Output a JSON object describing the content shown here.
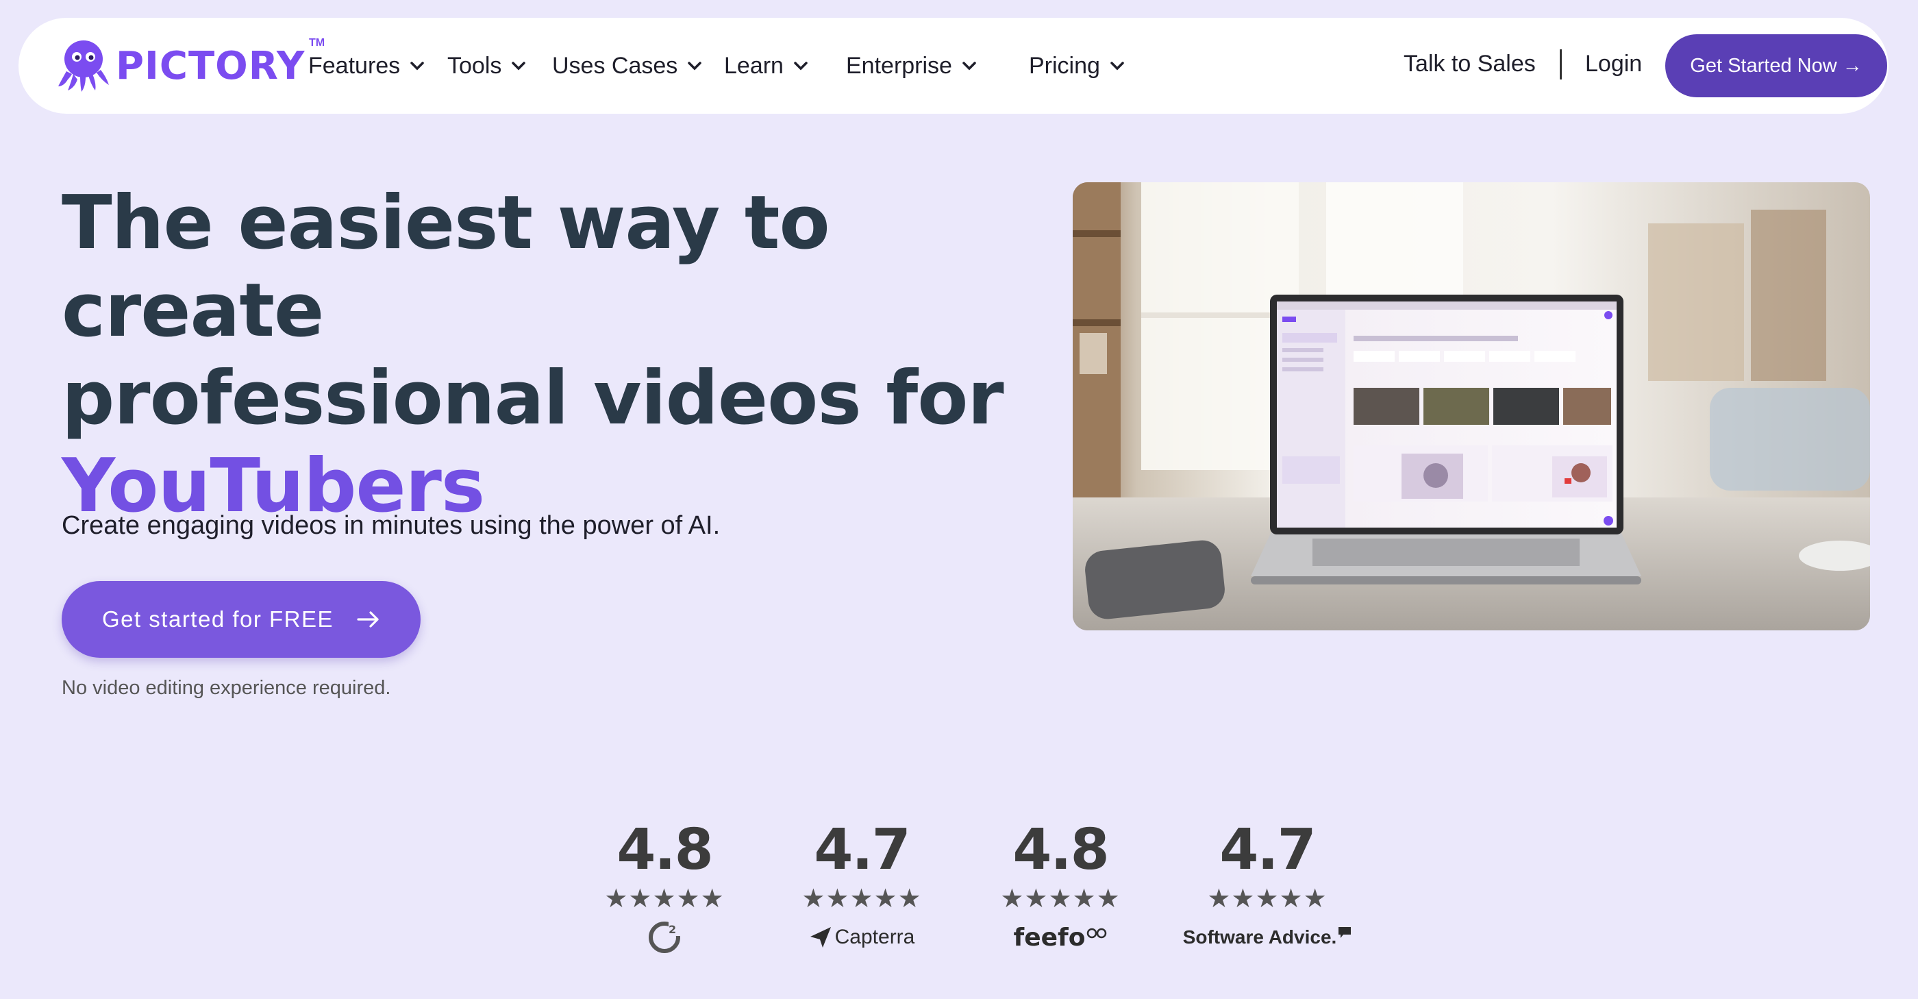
{
  "brand": {
    "name": "PICTORY",
    "trademark": "TM",
    "color": "#7b4cf0"
  },
  "nav": {
    "items": [
      {
        "label": "Features"
      },
      {
        "label": "Tools"
      },
      {
        "label": "Uses Cases"
      },
      {
        "label": "Learn"
      },
      {
        "label": "Enterprise"
      },
      {
        "label": "Pricing"
      }
    ],
    "talk_to_sales": "Talk to Sales",
    "login": "Login",
    "cta": "Get Started Now →"
  },
  "hero": {
    "headline_line1": "The easiest way to create",
    "headline_line2": "professional videos for",
    "headline_accent": "YouTubers",
    "subheadline": "Create engaging videos in minutes using the power of AI.",
    "cta": "Get started for FREE",
    "note": "No video editing experience required."
  },
  "ratings": [
    {
      "score": "4.8",
      "stars": "★★★★★",
      "source": "G2"
    },
    {
      "score": "4.7",
      "stars": "★★★★★",
      "source": "Capterra"
    },
    {
      "score": "4.8",
      "stars": "★★★★★",
      "source": "feefo"
    },
    {
      "score": "4.7",
      "stars": "★★★★★",
      "source": "Software Advice."
    }
  ],
  "colors": {
    "background": "#ebe8fb",
    "primary": "#5a3fb5",
    "accent": "#7350e3",
    "cta": "#7a58de"
  }
}
